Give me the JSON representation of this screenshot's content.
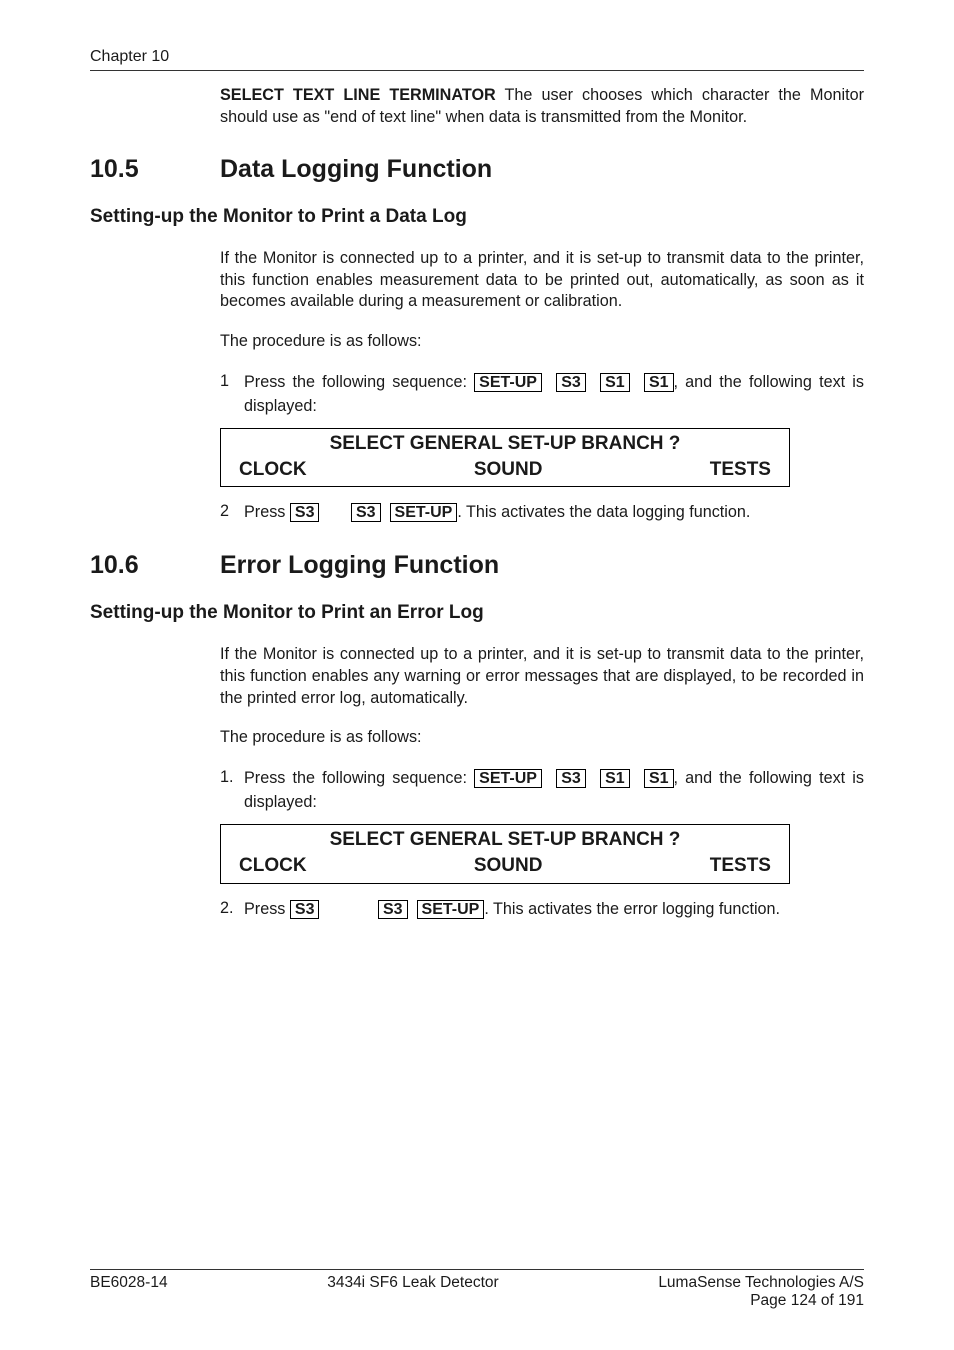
{
  "header": {
    "chapter": "Chapter 10"
  },
  "intro": {
    "lead_bold": "SELECT TEXT LINE TERMINATOR",
    "lead_rest": " The user chooses which character the Monitor should use as \"end of text line\" when data is transmitted from the Monitor."
  },
  "sec105": {
    "num": "10.5",
    "title": "Data Logging Function",
    "sub1": "Setting-up the Monitor to Print a Data Log",
    "p1": "If the Monitor is connected up to a printer, and it is set-up to transmit data to the printer, this function enables measurement data to be printed out, automatically, as soon as it becomes available during a measurement or calibration.",
    "p2": "The procedure is as follows:",
    "step1_num": "1",
    "step1_a": "Press the following sequence: ",
    "key_setup": "SET-UP",
    "key_s3": "S3",
    "key_s1": "S1",
    "step1_b": ", and the following text is displayed:",
    "display": {
      "title": "SELECT GENERAL SET-UP BRANCH ?",
      "left": "CLOCK",
      "mid": "SOUND",
      "right": "TESTS"
    },
    "step2_num": "2",
    "step2_a": "Press ",
    "step2_b": ". This activates the data logging function."
  },
  "sec106": {
    "num": "10.6",
    "title": "Error Logging Function",
    "sub1": "Setting-up the Monitor to Print an Error Log",
    "p1": "If the Monitor is connected up to a printer, and it is set-up to transmit data to the printer, this function enables any warning or error messages that are displayed, to be recorded in the printed error log, automatically.",
    "p2": "The procedure is as follows:",
    "step1_num": "1.",
    "step1_a": "Press the following sequence: ",
    "step1_b": ", and the following text is displayed:",
    "display": {
      "title": "SELECT GENERAL SET-UP BRANCH ?",
      "left": "CLOCK",
      "mid": "SOUND",
      "right": "TESTS"
    },
    "step2_num": "2.",
    "step2_a": "Press ",
    "step2_b": ". This activates the error logging function."
  },
  "footer": {
    "left": "BE6028-14",
    "center": "3434i SF6 Leak Detector",
    "right1": "LumaSense Technologies A/S",
    "right2": "Page 124 of 191"
  }
}
